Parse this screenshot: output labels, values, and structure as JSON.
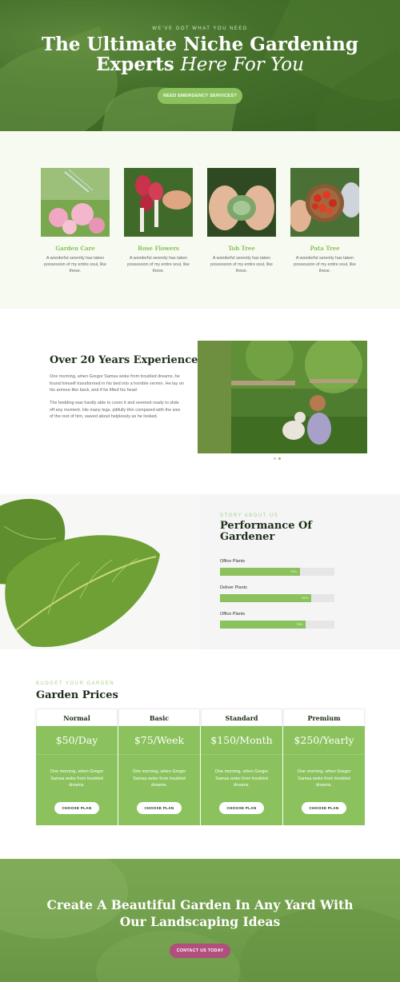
{
  "hero": {
    "eyebrow": "WE'VE GOT WHAT YOU NEED",
    "title_line1": "The Ultimate Niche Gardening",
    "title_line2_plain": "Experts ",
    "title_line2_italic": "Here For You",
    "button": "NEED EMERGENCY SERVICES?"
  },
  "services": [
    {
      "title": "Garden Care",
      "text": "A wonderful serenity has taken possession of my entire soul, like these."
    },
    {
      "title": "Rose Flowers",
      "text": "A wonderful serenity has taken possession of my entire soul, like these."
    },
    {
      "title": "Tob Tree",
      "text": "A wonderful serenity has taken possession of my entire soul, like these."
    },
    {
      "title": "Pata Tree",
      "text": "A wonderful serenity has taken possession of my entire soul, like these."
    }
  ],
  "experience": {
    "title": "Over 20 Years Experience",
    "p1": "One morning, when Gregor Samsa woke from troubled dreams, he found himself transformed in his bed into a horrible vermin. He lay on his armour-like back, and if he lifted his head",
    "p2": "The bedding was hardly able to cover it and seemed ready to slide off any moment. His many legs, pitifully thin compared with the size of the rest of him, waved about helplessly as he looked."
  },
  "performance": {
    "eyebrow": "STORY ABOUT US",
    "title": "Performance Of Gardener",
    "bars": [
      {
        "label": "Office Plants",
        "percent": 70,
        "text": "70%"
      },
      {
        "label": "Deliver Plants",
        "percent": 80,
        "text": "80%"
      },
      {
        "label": "Office Plants",
        "percent": 75,
        "text": "75%"
      }
    ]
  },
  "prices": {
    "eyebrow": "BUDGET YOUR GARDEN",
    "title": "Garden Prices",
    "plans": [
      {
        "name": "Normal",
        "price": "$50/Day",
        "text": "One morning, when Gregor Samsa woke from troubled dreams.",
        "button": "CHOOSE PLAN"
      },
      {
        "name": "Basic",
        "price": "$75/Week",
        "text": "One morning, when Gregor Samsa woke from troubled dreams.",
        "button": "CHOOSE PLAN"
      },
      {
        "name": "Standard",
        "price": "$150/Month",
        "text": "One morning, when Gregor Samsa woke from troubled dreams.",
        "button": "CHOOSE PLAN"
      },
      {
        "name": "Premium",
        "price": "$250/Yearly",
        "text": "One morning, when Gregor Samsa woke from troubled dreams.",
        "button": "CHOOSE PLAN"
      }
    ]
  },
  "cta": {
    "title": "Create A Beautiful Garden In Any Yard With Our Landscaping Ideas",
    "button": "CONTACT US TODAY"
  },
  "colors": {
    "accent": "#8bc25d",
    "cta_button": "#b14f7e",
    "dark_text": "#1f2e1a"
  }
}
